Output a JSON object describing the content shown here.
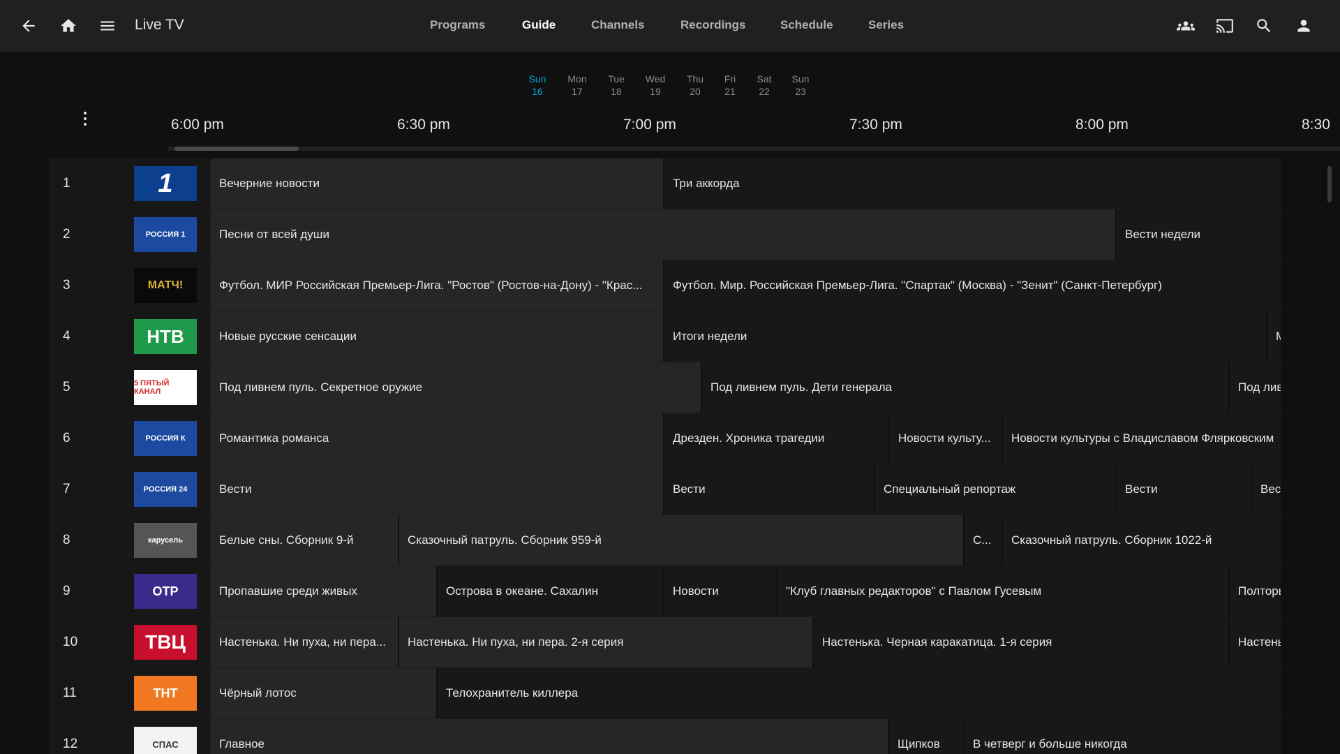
{
  "header": {
    "title": "Live TV",
    "tabs": [
      "Programs",
      "Guide",
      "Channels",
      "Recordings",
      "Schedule",
      "Series"
    ],
    "active_tab": "Guide"
  },
  "days": [
    {
      "name": "Sun",
      "num": "16",
      "active": true
    },
    {
      "name": "Mon",
      "num": "17"
    },
    {
      "name": "Tue",
      "num": "18"
    },
    {
      "name": "Wed",
      "num": "19"
    },
    {
      "name": "Thu",
      "num": "20"
    },
    {
      "name": "Fri",
      "num": "21"
    },
    {
      "name": "Sat",
      "num": "22"
    },
    {
      "name": "Sun",
      "num": "23"
    }
  ],
  "times": [
    "6:00 pm",
    "6:30 pm",
    "7:00 pm",
    "7:30 pm",
    "8:00 pm",
    "8:30"
  ],
  "channels": [
    {
      "number": "1",
      "logo": "1",
      "programs": [
        "Вечерние новости",
        "Три аккорда"
      ]
    },
    {
      "number": "2",
      "logo": "РОССИЯ 1",
      "programs": [
        "Песни от всей души",
        "Вести недели"
      ]
    },
    {
      "number": "3",
      "logo": "МАТЧ!",
      "programs": [
        "Футбол. МИР Российская Премьер-Лига. \"Ростов\" (Ростов-на-Дону) - \"Крас...",
        "Футбол. Мир. Российская Премьер-Лига. \"Спартак\" (Москва) - \"Зенит\" (Санкт-Петербург)"
      ]
    },
    {
      "number": "4",
      "logo": "НТВ",
      "programs": [
        "Новые русские сенсации",
        "Итоги недели",
        "М"
      ]
    },
    {
      "number": "5",
      "logo": "5 ПЯТЫЙ КАНАЛ",
      "programs": [
        "Под ливнем пуль. Секретное оружие",
        "Под ливнем пуль. Дети генерала",
        "Под лив"
      ]
    },
    {
      "number": "6",
      "logo": "РОССИЯ К",
      "programs": [
        "Романтика романса",
        "Дрезден. Хроника трагедии",
        "Новости культу...",
        "Новости культуры с Владиславом Флярковским"
      ]
    },
    {
      "number": "7",
      "logo": "РОССИЯ 24",
      "programs": [
        "Вести",
        "Вести",
        "Специальный репортаж",
        "Вести",
        "Вест"
      ]
    },
    {
      "number": "8",
      "logo": "карусель",
      "programs": [
        "Белые сны. Сборник 9-й",
        "Сказочный патруль. Сборник 959-й",
        "С...",
        "Сказочный патруль. Сборник 1022-й"
      ]
    },
    {
      "number": "9",
      "logo": "ОТР",
      "programs": [
        "Пропавшие среди живых",
        "Острова в океане. Сахалин",
        "Новости",
        "\"Клуб главных редакторов\" с Павлом Гусевым",
        "Полторы"
      ]
    },
    {
      "number": "10",
      "logo": "ТВЦ",
      "programs": [
        "Настенька. Ни пуха, ни пера...",
        "Настенька. Ни пуха, ни пера. 2-я серия",
        "Настенька. Черная каракатица. 1-я серия",
        "Настень"
      ]
    },
    {
      "number": "11",
      "logo": "ТНТ",
      "programs": [
        "Чёрный лотос",
        "Телохранитель киллера"
      ]
    },
    {
      "number": "12",
      "logo": "СПАС",
      "programs": [
        "Главное",
        "Щипков",
        "В четверг и больше никогда"
      ]
    }
  ],
  "colors": {
    "accent": "#00a4dc",
    "background": "#101010",
    "header": "#202020"
  }
}
